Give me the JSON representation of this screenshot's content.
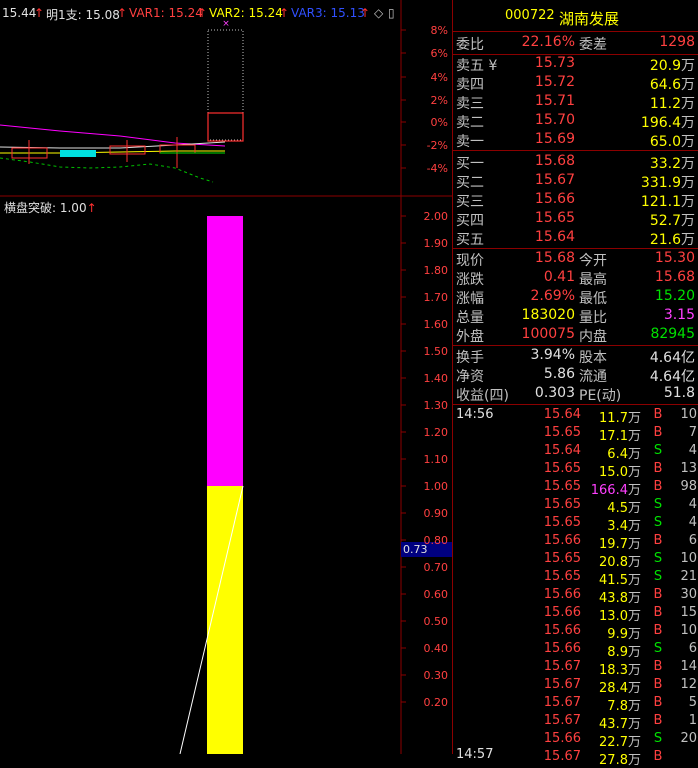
{
  "indicator_bar": {
    "price": "15.44",
    "tomorrow_label": "明1支: 15.08",
    "var1": "VAR1: 15.24",
    "var2": "VAR2: 15.24",
    "var3": "VAR3: 15.13",
    "icons": [
      "diamond-icon",
      "window-icon"
    ]
  },
  "price_axis": [
    "8%",
    "6%",
    "4%",
    "2%",
    "0%",
    "-2%",
    "-4%"
  ],
  "sub_indicator": {
    "label": "横盘突破: 1.00",
    "axis": [
      "2.00",
      "1.90",
      "1.80",
      "1.70",
      "1.60",
      "1.50",
      "1.40",
      "1.30",
      "1.20",
      "1.10",
      "1.00",
      "0.90",
      "0.80",
      "0.70",
      "0.60",
      "0.50",
      "0.40",
      "0.30",
      "0.20"
    ],
    "cursor_value": "0.73"
  },
  "colors": {
    "red": "#ff4040",
    "green": "#00e000",
    "yellow": "#ffff00",
    "magenta": "#ff00ff",
    "border": "#8b0000"
  },
  "stock": {
    "code": "000722",
    "name": "湖南发展"
  },
  "weibi": {
    "label": "委比",
    "value": "22.16%",
    "label2": "委差",
    "value2": "1298"
  },
  "sell": [
    {
      "label": "卖五 ¥",
      "price": "15.73",
      "vol": "20.9",
      "unit": "万"
    },
    {
      "label": "卖四",
      "price": "15.72",
      "vol": "64.6",
      "unit": "万"
    },
    {
      "label": "卖三",
      "price": "15.71",
      "vol": "11.2",
      "unit": "万"
    },
    {
      "label": "卖二",
      "price": "15.70",
      "vol": "196.4",
      "unit": "万"
    },
    {
      "label": "卖一",
      "price": "15.69",
      "vol": "65.0",
      "unit": "万"
    }
  ],
  "buy": [
    {
      "label": "买一",
      "price": "15.68",
      "vol": "33.2",
      "unit": "万"
    },
    {
      "label": "买二",
      "price": "15.67",
      "vol": "331.9",
      "unit": "万"
    },
    {
      "label": "买三",
      "price": "15.66",
      "vol": "121.1",
      "unit": "万"
    },
    {
      "label": "买四",
      "price": "15.65",
      "vol": "52.7",
      "unit": "万"
    },
    {
      "label": "买五",
      "price": "15.64",
      "vol": "21.6",
      "unit": "万"
    }
  ],
  "quote": [
    {
      "l1": "现价",
      "v1": "15.68",
      "c1": "red",
      "l2": "今开",
      "v2": "15.30",
      "c2": "red"
    },
    {
      "l1": "涨跌",
      "v1": "0.41",
      "c1": "red",
      "l2": "最高",
      "v2": "15.68",
      "c2": "red"
    },
    {
      "l1": "涨幅",
      "v1": "2.69%",
      "c1": "red",
      "l2": "最低",
      "v2": "15.20",
      "c2": "green"
    },
    {
      "l1": "总量",
      "v1": "183020",
      "c1": "yellow",
      "l2": "量比",
      "v2": "3.15",
      "c2": "magenta"
    },
    {
      "l1": "外盘",
      "v1": "100075",
      "c1": "red",
      "l2": "内盘",
      "v2": "82945",
      "c2": "green"
    }
  ],
  "fund": [
    {
      "l1": "换手",
      "v1": "3.94%",
      "l2": "股本",
      "v2": "4.64亿"
    },
    {
      "l1": "净资",
      "v1": "5.86",
      "l2": "流通",
      "v2": "4.64亿"
    },
    {
      "l1": "收益(四)",
      "v1": "0.303",
      "l2": "PE(动)",
      "v2": "51.8"
    }
  ],
  "ticks_time": "14:56",
  "ticks_time_next": "14:57",
  "ticks": [
    {
      "price": "15.64",
      "vol": "11.7",
      "bs": "B",
      "cnt": "10",
      "pc": "red",
      "vc": "yellow"
    },
    {
      "price": "15.65",
      "vol": "17.1",
      "bs": "B",
      "cnt": "7",
      "pc": "red",
      "vc": "yellow"
    },
    {
      "price": "15.64",
      "vol": "6.4",
      "bs": "S",
      "cnt": "4",
      "pc": "red",
      "vc": "yellow"
    },
    {
      "price": "15.65",
      "vol": "15.0",
      "bs": "B",
      "cnt": "13",
      "pc": "red",
      "vc": "yellow"
    },
    {
      "price": "15.65",
      "vol": "166.4",
      "bs": "B",
      "cnt": "98",
      "pc": "red",
      "vc": "magenta"
    },
    {
      "price": "15.65",
      "vol": "4.5",
      "bs": "S",
      "cnt": "4",
      "pc": "red",
      "vc": "yellow"
    },
    {
      "price": "15.65",
      "vol": "3.4",
      "bs": "S",
      "cnt": "4",
      "pc": "red",
      "vc": "yellow"
    },
    {
      "price": "15.66",
      "vol": "19.7",
      "bs": "B",
      "cnt": "6",
      "pc": "red",
      "vc": "yellow"
    },
    {
      "price": "15.65",
      "vol": "20.8",
      "bs": "S",
      "cnt": "10",
      "pc": "red",
      "vc": "yellow"
    },
    {
      "price": "15.65",
      "vol": "41.5",
      "bs": "S",
      "cnt": "21",
      "pc": "red",
      "vc": "yellow"
    },
    {
      "price": "15.66",
      "vol": "43.8",
      "bs": "B",
      "cnt": "30",
      "pc": "red",
      "vc": "yellow"
    },
    {
      "price": "15.66",
      "vol": "13.0",
      "bs": "B",
      "cnt": "15",
      "pc": "red",
      "vc": "yellow"
    },
    {
      "price": "15.66",
      "vol": "9.9",
      "bs": "B",
      "cnt": "10",
      "pc": "red",
      "vc": "yellow"
    },
    {
      "price": "15.66",
      "vol": "8.9",
      "bs": "S",
      "cnt": "6",
      "pc": "red",
      "vc": "yellow"
    },
    {
      "price": "15.67",
      "vol": "18.3",
      "bs": "B",
      "cnt": "14",
      "pc": "red",
      "vc": "yellow"
    },
    {
      "price": "15.67",
      "vol": "28.4",
      "bs": "B",
      "cnt": "12",
      "pc": "red",
      "vc": "yellow"
    },
    {
      "price": "15.67",
      "vol": "7.8",
      "bs": "B",
      "cnt": "5",
      "pc": "red",
      "vc": "yellow"
    },
    {
      "price": "15.67",
      "vol": "43.7",
      "bs": "B",
      "cnt": "1",
      "pc": "red",
      "vc": "yellow"
    },
    {
      "price": "15.66",
      "vol": "22.7",
      "bs": "S",
      "cnt": "20",
      "pc": "red",
      "vc": "yellow"
    },
    {
      "price": "15.67",
      "vol": "27.8",
      "bs": "B",
      "cnt": "",
      "pc": "red",
      "vc": "yellow"
    }
  ]
}
